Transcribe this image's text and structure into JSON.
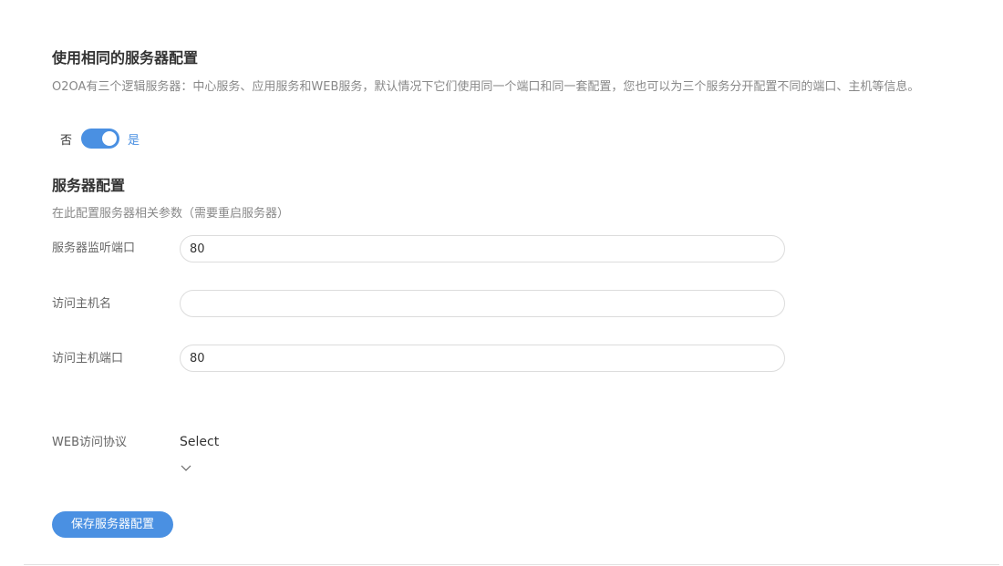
{
  "same_config": {
    "title": "使用相同的服务器配置",
    "description": "O2OA有三个逻辑服务器：中心服务、应用服务和WEB服务，默认情况下它们使用同一个端口和同一套配置，您也可以为三个服务分开配置不同的端口、主机等信息。",
    "toggle": {
      "off_label": "否",
      "on_label": "是",
      "state": "on"
    }
  },
  "server_config": {
    "title": "服务器配置",
    "description": "在此配置服务器相关参数（需要重启服务器）",
    "fields": {
      "listen_port": {
        "label": "服务器监听端口",
        "value": "80"
      },
      "host_name": {
        "label": "访问主机名",
        "value": ""
      },
      "host_port": {
        "label": "访问主机端口",
        "value": "80"
      },
      "protocol": {
        "label": "WEB访问协议",
        "value": "Select"
      }
    },
    "save_label": "保存服务器配置"
  },
  "icons": {
    "select_chevron": "chevron-down-icon"
  },
  "colors": {
    "accent": "#4a90e2",
    "text": "#333333",
    "muted": "#888888",
    "border": "#dcdcdc"
  }
}
